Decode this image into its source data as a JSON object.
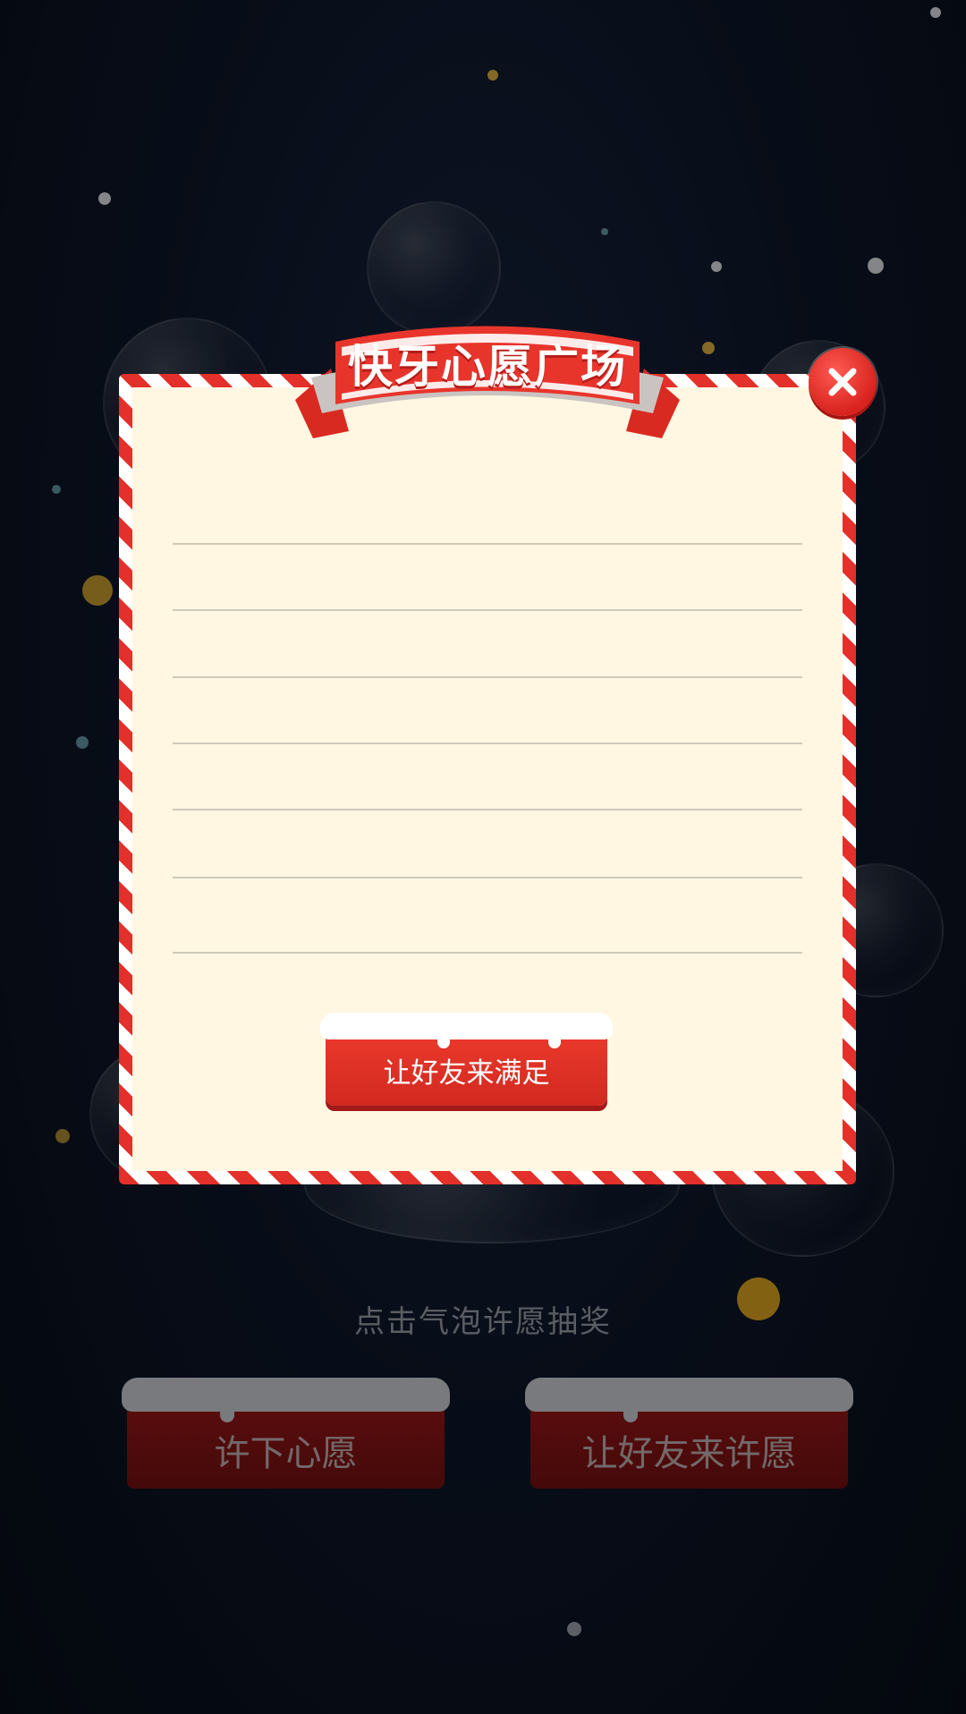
{
  "background": {
    "hint_text": "点击气泡许愿抽奖"
  },
  "actions": {
    "wish_label": "许下心愿",
    "friend_wish_label": "让好友来许愿"
  },
  "modal": {
    "title": "快牙心愿广场",
    "satisfy_label": "让好友来满足",
    "close_icon": "close-icon"
  },
  "colors": {
    "accent_red": "#e3302a",
    "paper": "#fff7e2",
    "background": "#0b1220"
  }
}
